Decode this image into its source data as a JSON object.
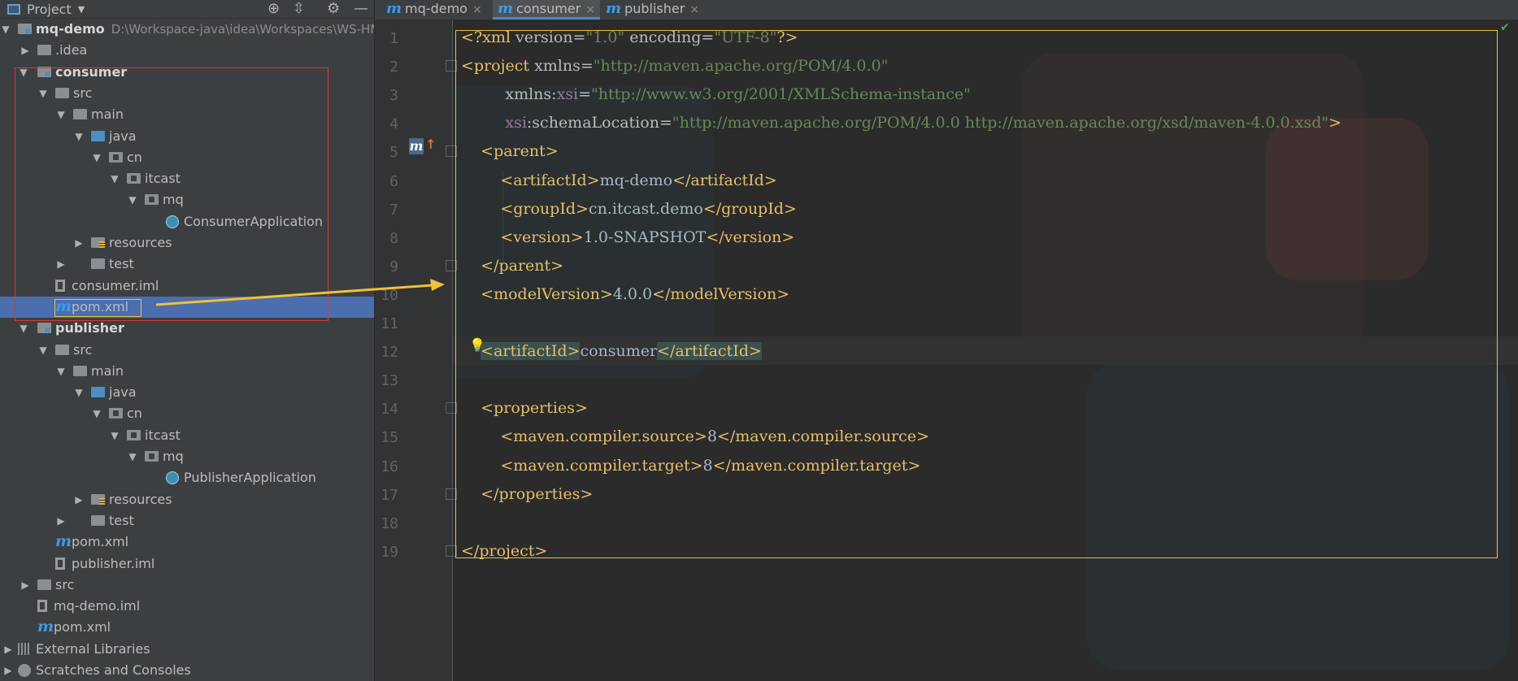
{
  "panel": {
    "title": "Project",
    "caret": "▼",
    "icons": [
      "locate-icon",
      "collapse-icon",
      "gear-icon",
      "minimize-icon"
    ]
  },
  "tree": [
    {
      "label": "mq-demo",
      "path": "D:\\Workspace-java\\idea\\Workspaces\\WS-HM-",
      "bold": true,
      "arrow": "▼",
      "icon": "module-folder"
    },
    {
      "label": ".idea",
      "arrow": "▶",
      "icon": "folder"
    },
    {
      "label": "consumer",
      "bold": true,
      "arrow": "▼",
      "icon": "module-folder"
    },
    {
      "label": "src",
      "arrow": "▼",
      "icon": "folder"
    },
    {
      "label": "main",
      "arrow": "▼",
      "icon": "folder"
    },
    {
      "label": "java",
      "arrow": "▼",
      "icon": "source-folder"
    },
    {
      "label": "cn",
      "arrow": "▼",
      "icon": "package"
    },
    {
      "label": "itcast",
      "arrow": "▼",
      "icon": "package"
    },
    {
      "label": "mq",
      "arrow": "▼",
      "icon": "package"
    },
    {
      "label": "ConsumerApplication",
      "icon": "class"
    },
    {
      "label": "resources",
      "arrow": "▶",
      "icon": "resources-folder"
    },
    {
      "label": "test",
      "arrow": "▶",
      "icon": "folder"
    },
    {
      "label": "consumer.iml",
      "icon": "iml"
    },
    {
      "label": "pom.xml",
      "icon": "maven",
      "selected": true
    },
    {
      "label": "publisher",
      "bold": true,
      "arrow": "▼",
      "icon": "module-folder"
    },
    {
      "label": "src",
      "arrow": "▼",
      "icon": "folder"
    },
    {
      "label": "main",
      "arrow": "▼",
      "icon": "folder"
    },
    {
      "label": "java",
      "arrow": "▼",
      "icon": "source-folder"
    },
    {
      "label": "cn",
      "arrow": "▼",
      "icon": "package"
    },
    {
      "label": "itcast",
      "arrow": "▼",
      "icon": "package"
    },
    {
      "label": "mq",
      "arrow": "▼",
      "icon": "package"
    },
    {
      "label": "PublisherApplication",
      "icon": "class"
    },
    {
      "label": "resources",
      "arrow": "▶",
      "icon": "resources-folder"
    },
    {
      "label": "test",
      "arrow": "▶",
      "icon": "folder"
    },
    {
      "label": "pom.xml",
      "icon": "maven"
    },
    {
      "label": "publisher.iml",
      "icon": "iml"
    },
    {
      "label": "src",
      "arrow": "▶",
      "icon": "folder"
    },
    {
      "label": "mq-demo.iml",
      "icon": "iml"
    },
    {
      "label": "pom.xml",
      "icon": "maven"
    },
    {
      "label": "External Libraries",
      "arrow": "▶",
      "icon": "libraries"
    },
    {
      "label": "Scratches and Consoles",
      "arrow": "▶",
      "icon": "scratches"
    }
  ],
  "tabs": [
    {
      "label": "mq-demo",
      "active": false
    },
    {
      "label": "consumer",
      "active": true
    },
    {
      "label": "publisher",
      "active": false
    }
  ],
  "tab_icon": "m",
  "tab_close": "×",
  "maven_glyph": "m",
  "colors": {
    "selection": "#4b6eaf",
    "highlight_box": "#f0c037",
    "consumer_box": "#d93832",
    "xml_tag": "#e8bf6a",
    "xml_value": "#6a8759",
    "xml_namespace": "#9876aa"
  },
  "code": [
    [
      [
        "brk",
        "<?xml "
      ],
      [
        "attr",
        "version="
      ],
      [
        "val",
        "\"1.0\""
      ],
      [
        "attr",
        " encoding="
      ],
      [
        "val",
        "\"UTF-8\""
      ],
      [
        "brk",
        "?>"
      ]
    ],
    [
      [
        "brk",
        "<project "
      ],
      [
        "attr",
        "xmlns="
      ],
      [
        "val",
        "\"http://maven.apache.org/POM/4.0.0\""
      ]
    ],
    [
      [
        "attr",
        "         xmlns:"
      ],
      [
        "ns",
        "xsi"
      ],
      [
        "attr",
        "="
      ],
      [
        "val",
        "\"http://www.w3.org/2001/XMLSchema-instance\""
      ]
    ],
    [
      [
        "ns",
        "         xsi"
      ],
      [
        "attr",
        ":schemaLocation="
      ],
      [
        "val",
        "\"http://maven.apache.org/POM/4.0.0 http://maven.apache.org/xsd/maven-4.0.0.xsd\""
      ],
      [
        "brk",
        ">"
      ]
    ],
    [
      [
        "brk",
        "    <parent>"
      ]
    ],
    [
      [
        "brk",
        "        <artifactId>"
      ],
      [
        "txt",
        "mq-demo"
      ],
      [
        "brk",
        "</artifactId>"
      ]
    ],
    [
      [
        "brk",
        "        <groupId>"
      ],
      [
        "txt",
        "cn.itcast.demo"
      ],
      [
        "brk",
        "</groupId>"
      ]
    ],
    [
      [
        "brk",
        "        <version>"
      ],
      [
        "txt",
        "1.0-SNAPSHOT"
      ],
      [
        "brk",
        "</version>"
      ]
    ],
    [
      [
        "brk",
        "    </parent>"
      ]
    ],
    [
      [
        "brk",
        "    <modelVersion>"
      ],
      [
        "txt",
        "4.0.0"
      ],
      [
        "brk",
        "</modelVersion>"
      ]
    ],
    [],
    [
      [
        "txt",
        "    "
      ],
      [
        "hl",
        "<artifactId>"
      ],
      [
        "txt",
        "consumer"
      ],
      [
        "hl",
        "</artifactId>"
      ]
    ],
    [],
    [
      [
        "brk",
        "    <properties>"
      ]
    ],
    [
      [
        "brk",
        "        <maven.compiler.source>"
      ],
      [
        "txt",
        "8"
      ],
      [
        "brk",
        "</maven.compiler.source>"
      ]
    ],
    [
      [
        "brk",
        "        <maven.compiler.target>"
      ],
      [
        "txt",
        "8"
      ],
      [
        "brk",
        "</maven.compiler.target>"
      ]
    ],
    [
      [
        "brk",
        "    </properties>"
      ]
    ],
    [],
    [
      [
        "brk",
        "</project>"
      ]
    ]
  ],
  "line_numbers": [
    "1",
    "2",
    "3",
    "4",
    "5",
    "6",
    "7",
    "8",
    "9",
    "10",
    "11",
    "12",
    "13",
    "14",
    "15",
    "16",
    "17",
    "18",
    "19"
  ]
}
